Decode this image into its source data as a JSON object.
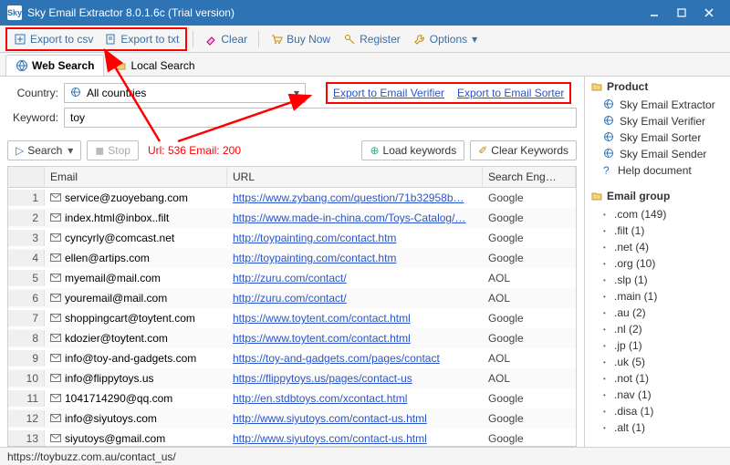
{
  "window": {
    "title": "Sky Email Extractor 8.0.1.6c (Trial version)",
    "logo_text": "Sky"
  },
  "toolbar": {
    "export_csv": "Export to csv",
    "export_txt": "Export to txt",
    "clear": "Clear",
    "buy": "Buy Now",
    "register": "Register",
    "options": "Options"
  },
  "tabs": {
    "web": "Web Search",
    "local": "Local Search"
  },
  "form": {
    "country_label": "Country:",
    "country_value": "All countries",
    "keyword_label": "Keyword:",
    "keyword_value": "toy"
  },
  "links": {
    "verifier": "Export to Email Verifier",
    "sorter": "Export to Email Sorter"
  },
  "controls": {
    "search": "Search",
    "stop": "Stop",
    "stats": "Url: 536 Email: 200",
    "load_kw": "Load keywords",
    "clear_kw": "Clear Keywords"
  },
  "grid": {
    "head_email": "Email",
    "head_url": "URL",
    "head_engine": "Search Eng…",
    "rows": [
      {
        "n": "1",
        "email": "service@zuoyebang.com",
        "url": "https://www.zybang.com/question/71b32958b…",
        "engine": "Google"
      },
      {
        "n": "2",
        "email": "index.html@inbox..filt",
        "url": "https://www.made-in-china.com/Toys-Catalog/…",
        "engine": "Google"
      },
      {
        "n": "3",
        "email": "cyncyrly@comcast.net",
        "url": "http://toypainting.com/contact.htm",
        "engine": "Google"
      },
      {
        "n": "4",
        "email": "ellen@artips.com",
        "url": "http://toypainting.com/contact.htm",
        "engine": "Google"
      },
      {
        "n": "5",
        "email": "myemail@mail.com",
        "url": "http://zuru.com/contact/",
        "engine": "AOL"
      },
      {
        "n": "6",
        "email": "youremail@mail.com",
        "url": "http://zuru.com/contact/",
        "engine": "AOL"
      },
      {
        "n": "7",
        "email": "shoppingcart@toytent.com",
        "url": "https://www.toytent.com/contact.html",
        "engine": "Google"
      },
      {
        "n": "8",
        "email": "kdozier@toytent.com",
        "url": "https://www.toytent.com/contact.html",
        "engine": "Google"
      },
      {
        "n": "9",
        "email": "info@toy-and-gadgets.com",
        "url": "https://toy-and-gadgets.com/pages/contact",
        "engine": "AOL"
      },
      {
        "n": "10",
        "email": "info@flippytoys.us",
        "url": "https://flippytoys.us/pages/contact-us",
        "engine": "AOL"
      },
      {
        "n": "11",
        "email": "1041714290@qq.com",
        "url": "http://en.stdbtoys.com/xcontact.html",
        "engine": "Google"
      },
      {
        "n": "12",
        "email": "info@siyutoys.com",
        "url": "http://www.siyutoys.com/contact-us.html",
        "engine": "Google"
      },
      {
        "n": "13",
        "email": "siyutoys@gmail.com",
        "url": "http://www.siyutoys.com/contact-us.html",
        "engine": "Google"
      }
    ]
  },
  "side": {
    "product_title": "Product",
    "products": [
      "Sky Email Extractor",
      "Sky Email Verifier",
      "Sky Email Sorter",
      "Sky Email Sender",
      "Help document"
    ],
    "group_title": "Email group",
    "groups": [
      ".com (149)",
      ".filt (1)",
      ".net (4)",
      ".org (10)",
      ".slp (1)",
      ".main (1)",
      ".au (2)",
      ".nl (2)",
      ".jp (1)",
      ".uk (5)",
      ".not (1)",
      ".nav (1)",
      ".disa (1)",
      ".alt (1)"
    ]
  },
  "statusbar": {
    "text": "https://toybuzz.com.au/contact_us/"
  }
}
